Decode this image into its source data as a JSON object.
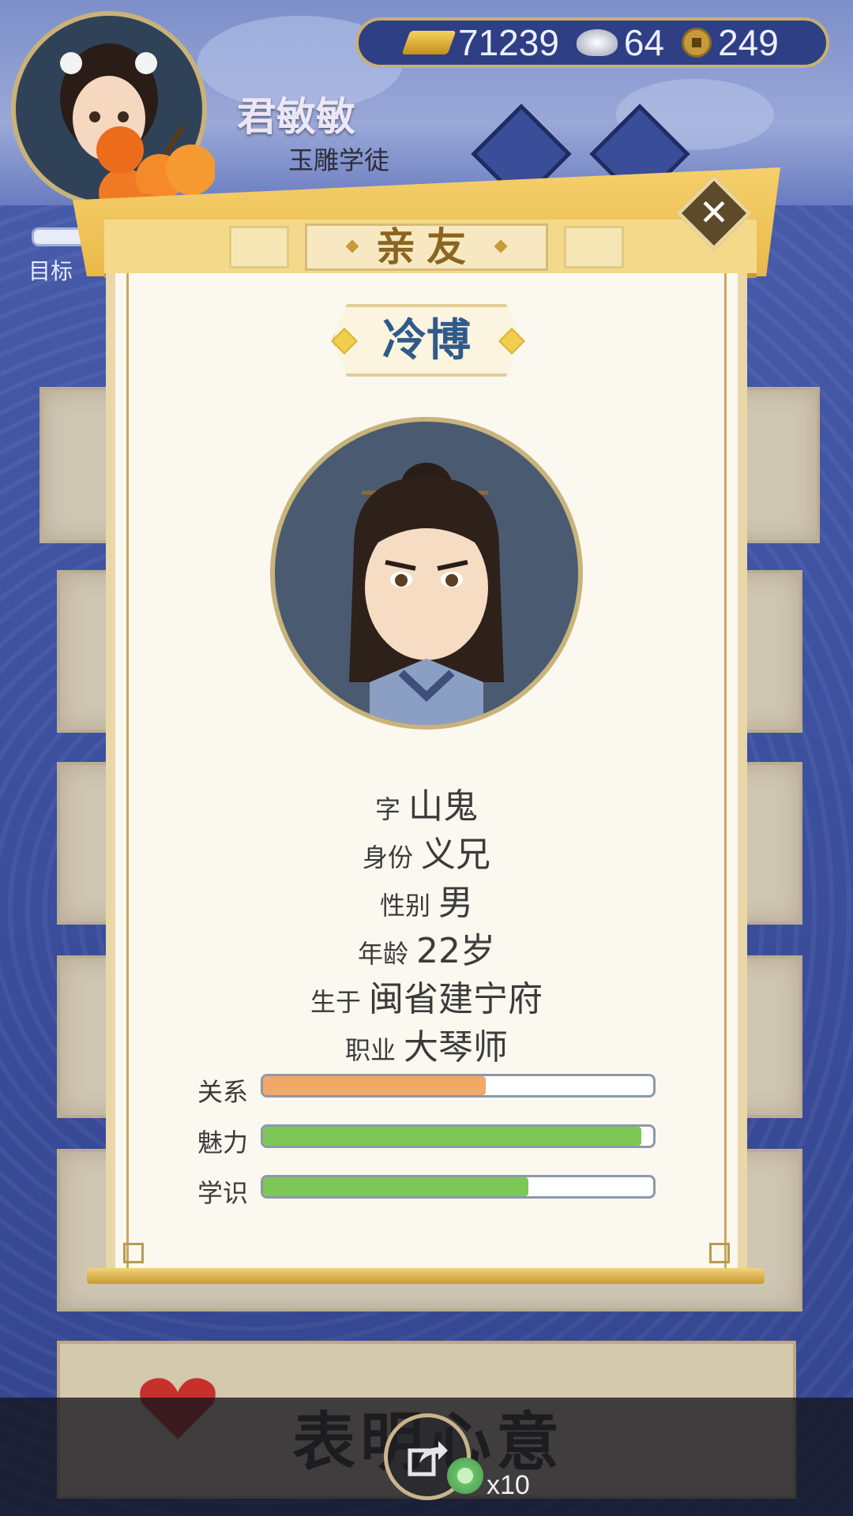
{
  "player": {
    "name": "君敏敏",
    "title": "玉雕学徒",
    "goal_label": "目标"
  },
  "currency": {
    "gold": "71239",
    "silver": "64",
    "coins": "249"
  },
  "dialog": {
    "header": "亲友",
    "character_name": "冷博",
    "info": [
      {
        "key": "字",
        "value": "山鬼"
      },
      {
        "key": "身份",
        "value": "义兄"
      },
      {
        "key": "性别",
        "value": "男"
      },
      {
        "key": "年龄",
        "value": "22岁"
      },
      {
        "key": "生于",
        "value": "闽省建宁府"
      },
      {
        "key": "职业",
        "value": "大琴师"
      }
    ],
    "stats": [
      {
        "label": "关系",
        "fraction": 0.57,
        "color": "#f2a866"
      },
      {
        "label": "魅力",
        "fraction": 0.97,
        "color": "#7cc756"
      },
      {
        "label": "学识",
        "fraction": 0.68,
        "color": "#7cc756"
      }
    ]
  },
  "bottom": {
    "action_text": "表明心意",
    "cost": "x10"
  },
  "icons": {
    "gold": "gold-ingot-icon",
    "silver": "silver-ingot-icon",
    "coin": "copper-coin-icon",
    "close": "close-icon",
    "share": "share-icon",
    "jade": "jade-token-icon",
    "heart": "heart-icon"
  }
}
